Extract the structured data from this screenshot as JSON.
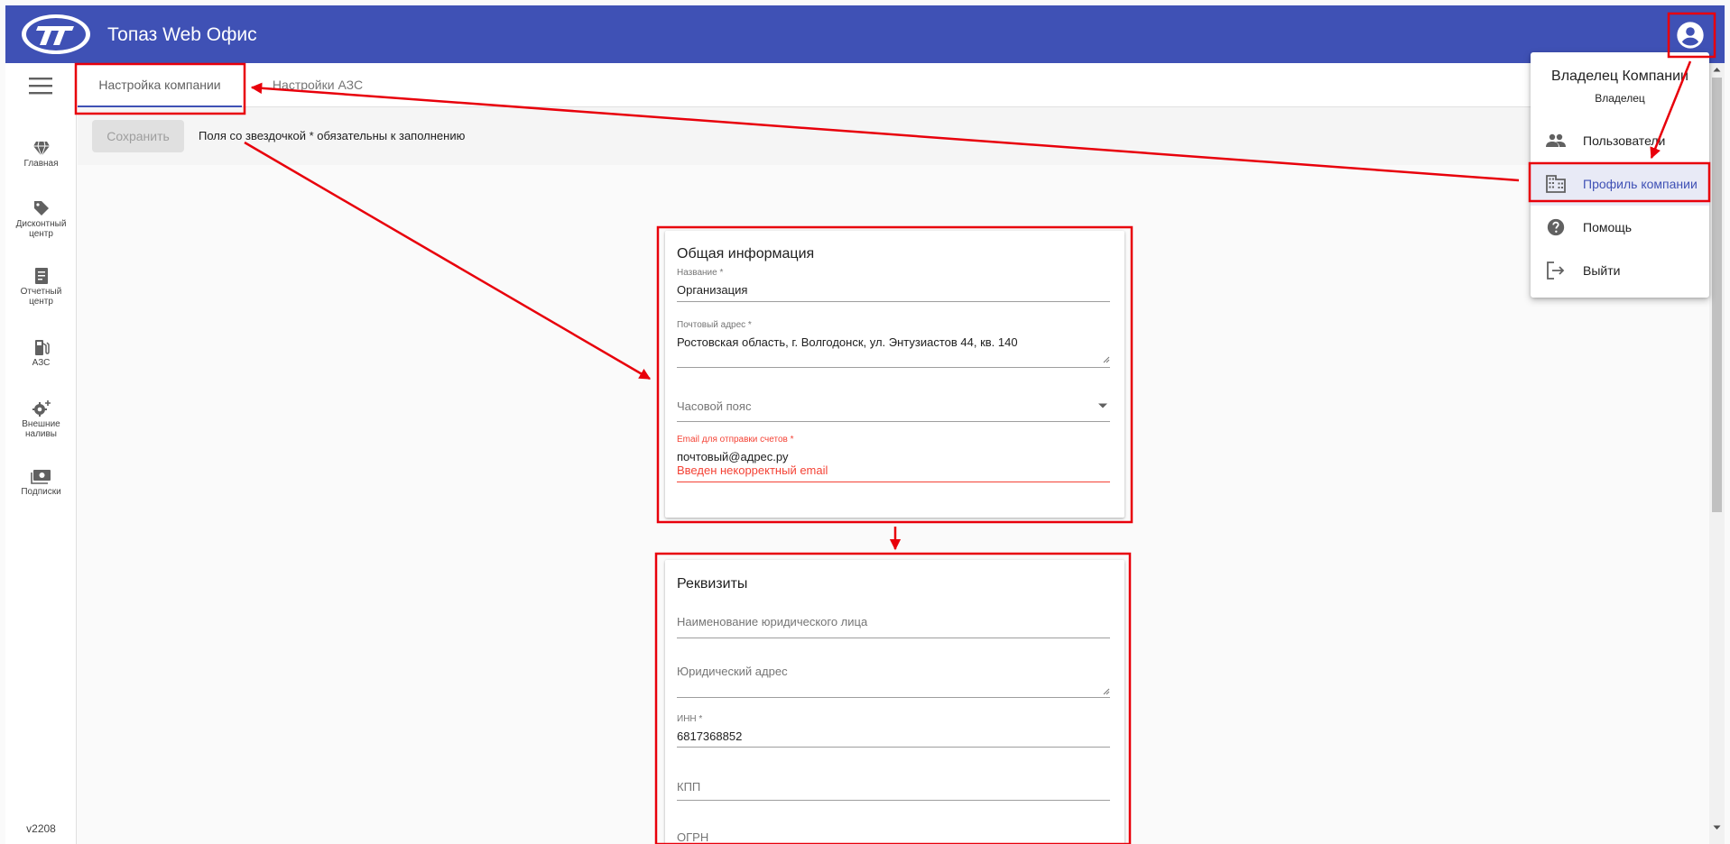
{
  "header": {
    "title": "Топаз Web Офис",
    "color": "#3f51b5"
  },
  "sidebar": {
    "items": [
      {
        "label": "Главная",
        "icon": "gem-icon"
      },
      {
        "label": "Дисконтный центр",
        "icon": "tag-icon"
      },
      {
        "label": "Отчетный центр",
        "icon": "report-icon"
      },
      {
        "label": "АЗС",
        "icon": "fuel-pump-icon"
      },
      {
        "label": "Внешние наливы",
        "icon": "gear-plus-icon"
      },
      {
        "label": "Подписки",
        "icon": "cash-icon"
      }
    ],
    "version": "v2208"
  },
  "tabs": [
    {
      "label": "Настройка компании",
      "active": true
    },
    {
      "label": "Настройки АЗС",
      "active": false
    }
  ],
  "toolbar": {
    "save_label": "Сохранить",
    "hint": "Поля со звездочкой * обязательны к заполнению"
  },
  "general_card": {
    "title": "Общая информация",
    "name_label": "Название *",
    "name_value": "Организация",
    "address_label": "Почтовый адрес *",
    "address_value": "Ростовская область, г. Волгодонск, ул. Энтузиастов 44, кв. 140",
    "timezone_placeholder": "Часовой пояс",
    "email_label": "Email для отправки счетов *",
    "email_value": "почтовый@адрес.ру",
    "email_error": "Введен некорректный email"
  },
  "requisites_card": {
    "title": "Реквизиты",
    "legal_name_placeholder": "Наименование юридического лица",
    "legal_address_placeholder": "Юридический адрес",
    "inn_label": "ИНН *",
    "inn_value": "6817368852",
    "kpp_placeholder": "КПП",
    "ogrn_placeholder": "ОГРН"
  },
  "account_menu": {
    "name": "Владелец Компании",
    "role": "Владелец",
    "items": [
      {
        "label": "Пользователи",
        "icon": "people-icon",
        "active": false
      },
      {
        "label": "Профиль компании",
        "icon": "building-icon",
        "active": true
      },
      {
        "label": "Помощь",
        "icon": "help-icon",
        "active": false
      },
      {
        "label": "Выйти",
        "icon": "logout-icon",
        "active": false
      }
    ]
  },
  "colors": {
    "primary": "#3f51b5",
    "error": "#f44336",
    "annotation": "#e8000b"
  }
}
